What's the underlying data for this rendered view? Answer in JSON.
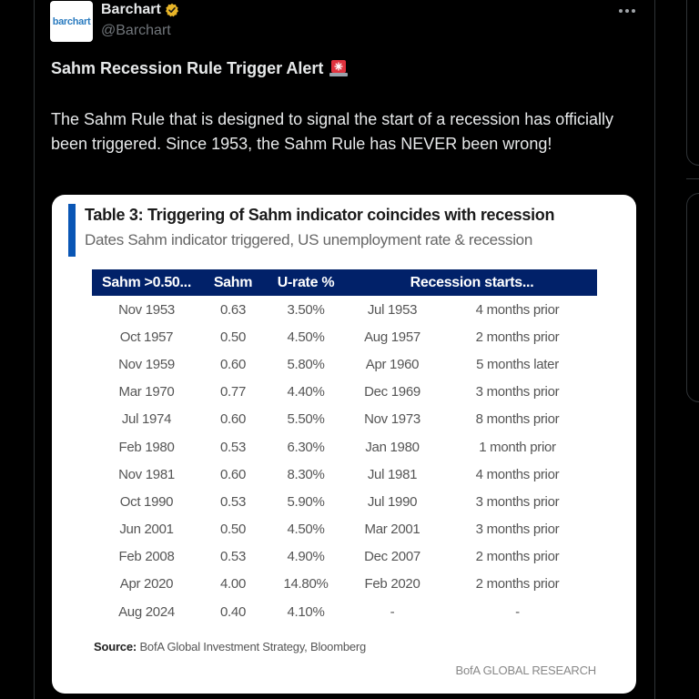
{
  "tweet": {
    "author_name": "Barchart",
    "author_handle": "@Barchart",
    "avatar_text": "barchart",
    "verified": true,
    "headline": "Sahm Recession Rule Trigger Alert",
    "headline_emoji": "siren",
    "body": "The Sahm Rule that is designed to signal the start of a recession has officially been triggered.  Since 1953, the Sahm Rule has NEVER been wrong!"
  },
  "media": {
    "title": "Table 3: Triggering of Sahm indicator coincides with recession",
    "subtitle": "Dates Sahm indicator triggered, US unemployment rate & recession",
    "columns": [
      "Sahm >0.50...",
      "Sahm",
      "U-rate %",
      "Recession starts..."
    ],
    "rows": [
      {
        "trigger": "Nov 1953",
        "sahm": "0.63",
        "urate": "3.50%",
        "recession": "Jul 1953",
        "lag": "4 months prior"
      },
      {
        "trigger": "Oct 1957",
        "sahm": "0.50",
        "urate": "4.50%",
        "recession": "Aug 1957",
        "lag": "2 months prior"
      },
      {
        "trigger": "Nov 1959",
        "sahm": "0.60",
        "urate": "5.80%",
        "recession": "Apr 1960",
        "lag": "5 months later"
      },
      {
        "trigger": "Mar 1970",
        "sahm": "0.77",
        "urate": "4.40%",
        "recession": "Dec 1969",
        "lag": "3 months prior"
      },
      {
        "trigger": "Jul 1974",
        "sahm": "0.60",
        "urate": "5.50%",
        "recession": "Nov 1973",
        "lag": "8 months prior"
      },
      {
        "trigger": "Feb 1980",
        "sahm": "0.53",
        "urate": "6.30%",
        "recession": "Jan 1980",
        "lag": "1 month prior"
      },
      {
        "trigger": "Nov 1981",
        "sahm": "0.60",
        "urate": "8.30%",
        "recession": "Jul 1981",
        "lag": "4 months prior"
      },
      {
        "trigger": "Oct 1990",
        "sahm": "0.53",
        "urate": "5.90%",
        "recession": "Jul 1990",
        "lag": "3 months prior"
      },
      {
        "trigger": "Jun 2001",
        "sahm": "0.50",
        "urate": "4.50%",
        "recession": "Mar 2001",
        "lag": "3 months prior"
      },
      {
        "trigger": "Feb 2008",
        "sahm": "0.53",
        "urate": "4.90%",
        "recession": "Dec 2007",
        "lag": "2 months prior"
      },
      {
        "trigger": "Apr 2020",
        "sahm": "4.00",
        "urate": "14.80%",
        "recession": "Feb 2020",
        "lag": "2 months prior"
      },
      {
        "trigger": "Aug 2024",
        "sahm": "0.40",
        "urate": "4.10%",
        "recession": "-",
        "lag": "-"
      }
    ],
    "source_label": "Source:",
    "source_text": "BofA Global Investment Strategy, Bloomberg",
    "brand": "BofA GLOBAL RESEARCH"
  },
  "colors": {
    "background": "#000000",
    "table_header": "#012169",
    "accent_bar": "#0a56b5",
    "verified_badge": "#e8b528",
    "siren": "#e0323e"
  }
}
